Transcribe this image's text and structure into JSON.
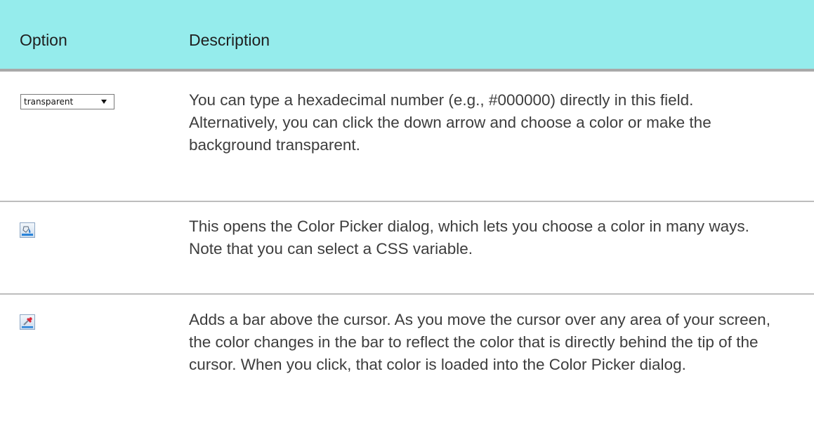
{
  "header": {
    "option": "Option",
    "description": "Description"
  },
  "rows": [
    {
      "control": {
        "type": "select",
        "value": "transparent"
      },
      "description": "You can type a hexadecimal number (e.g., #000000) directly in this field. Alternatively, you can click the down arrow and choose a color or make the background transparent."
    },
    {
      "control": {
        "type": "icon",
        "icon": "color-picker-icon"
      },
      "description": "This opens the Color Picker dialog, which lets you choose a color in many ways. Note that you can select a CSS variable."
    },
    {
      "control": {
        "type": "icon",
        "icon": "eyedropper-icon"
      },
      "description": "Adds a bar above the cursor. As you move the cursor over any area of your screen, the color changes in the bar to reflect the color that is directly behind the tip of the cursor. When you click, that color is loaded into the Color Picker dialog."
    }
  ],
  "colors": {
    "header_bg": "#95ecec",
    "header_rule": "#a9a9a9",
    "row_rule": "#bdbdbd"
  }
}
